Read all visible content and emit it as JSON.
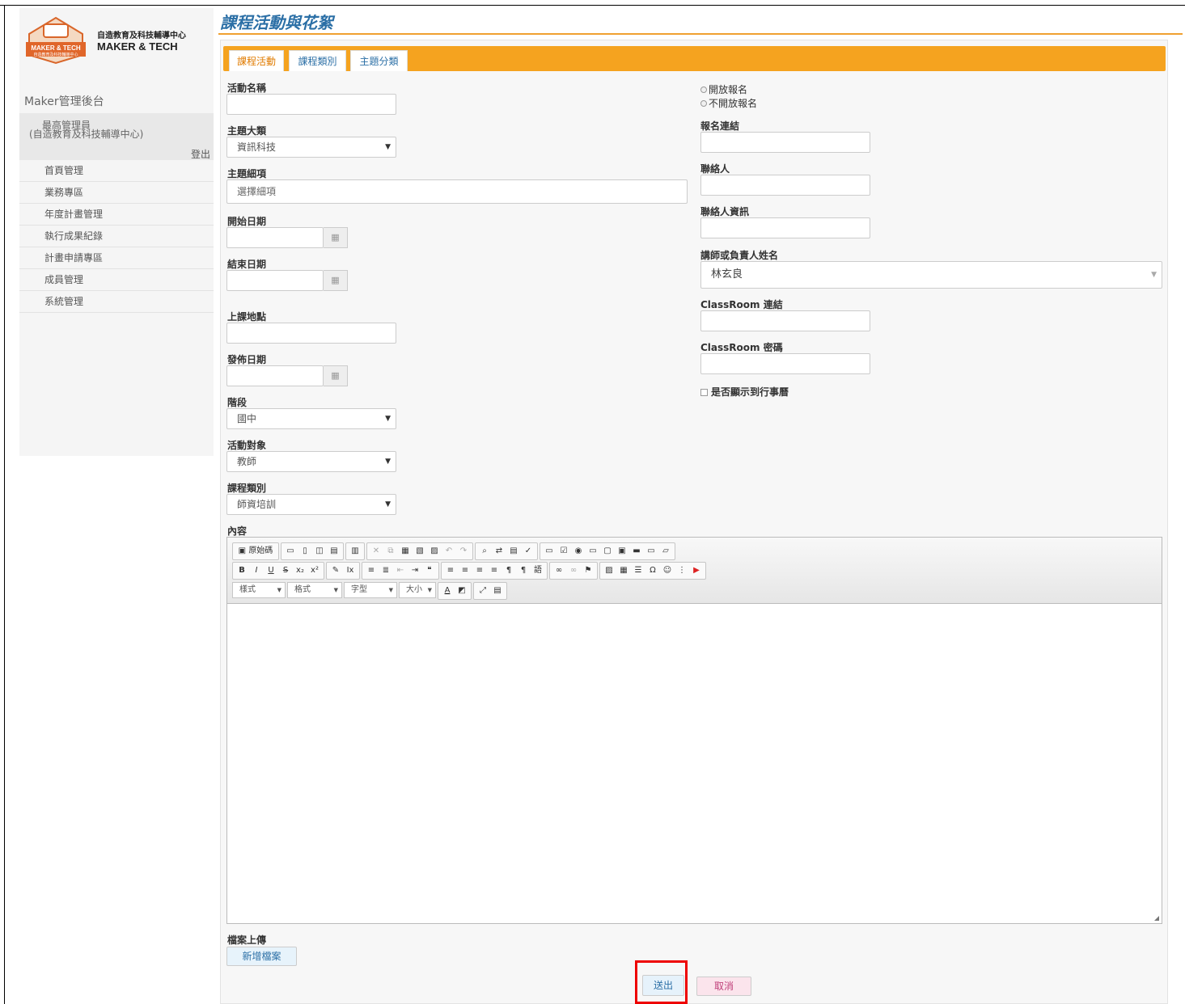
{
  "logo": {
    "badge_text": "MAKER & TECH",
    "badge_sub": "自造教育及科技輔導中心",
    "name_cn": "自造教育及科技輔導中心",
    "name_en": "MAKER & TECH"
  },
  "sidebar": {
    "brand": "Maker管理後台",
    "user_role": "最高管理員",
    "user_org": "(自造教育及科技輔導中心)",
    "logout": "登出",
    "menu": [
      "首頁管理",
      "業務專區",
      "年度計畫管理",
      "執行成果紀錄",
      "計畫申請專區",
      "成員管理",
      "系統管理"
    ]
  },
  "page": {
    "title": "課程活動與花絮",
    "tabs": [
      "課程活動",
      "課程類別",
      "主題分類"
    ]
  },
  "form": {
    "activity_name_label": "活動名稱",
    "theme_major_label": "主題大類",
    "theme_major_value": "資訊科技",
    "theme_detail_label": "主題細項",
    "theme_detail_placeholder": "選擇細項",
    "start_date_label": "開始日期",
    "end_date_label": "結束日期",
    "location_label": "上課地點",
    "publish_date_label": "發佈日期",
    "stage_label": "階段",
    "stage_value": "國中",
    "target_label": "活動對象",
    "target_value": "教師",
    "course_type_label": "課程類別",
    "course_type_value": "師資培訓",
    "open_reg": "開放報名",
    "closed_reg": "不開放報名",
    "reg_link_label": "報名連結",
    "contact_label": "聯絡人",
    "contact_info_label": "聯絡人資訊",
    "instructor_label": "講師或負責人姓名",
    "instructor_value": "林玄良",
    "classroom_link_label": "ClassRoom 連結",
    "classroom_pw_label": "ClassRoom 密碼",
    "show_calendar_label": "是否顯示到行事曆",
    "content_label": "內容",
    "upload_label": "檔案上傳",
    "add_file": "新增檔案",
    "submit": "送出",
    "cancel": "取消"
  },
  "editor": {
    "source_label": "原始碼",
    "combo_style": "樣式",
    "combo_format": "格式",
    "combo_font": "字型",
    "combo_size": "大小"
  },
  "colors": {
    "accent_orange": "#f5a31f",
    "title_blue": "#2b6fa6",
    "highlight_red": "#ee0000"
  }
}
